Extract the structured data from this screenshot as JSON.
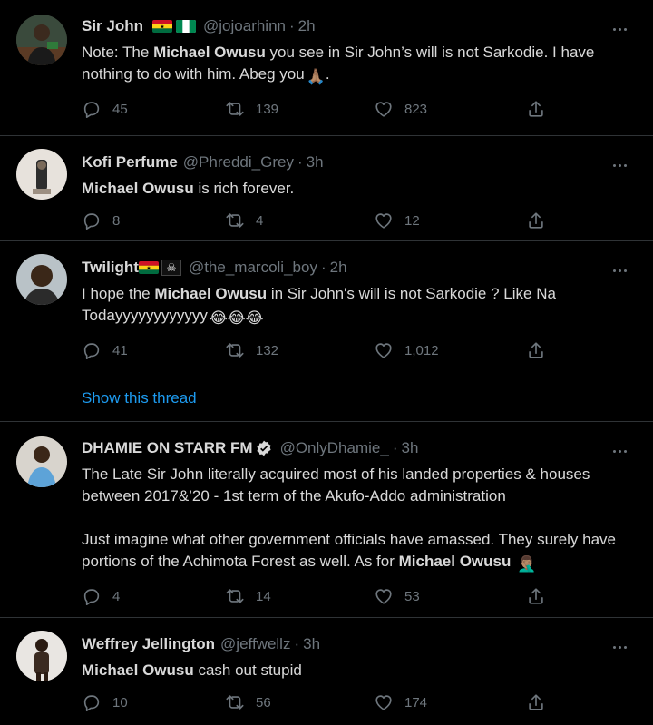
{
  "tweets": [
    {
      "name": "Sir John",
      "handle": "@jojoarhinn",
      "sep": "·",
      "time": "2h",
      "text_parts": [
        "Note: The ",
        "Michael Owusu",
        " you see in Sir John’s will is not Sarkodie. I have nothing to do with him. Abeg you",
        "🙏🏽",
        "."
      ],
      "replies": "45",
      "retweets": "139",
      "likes": "823"
    },
    {
      "name": "Kofi Perfume",
      "handle": "@Phreddi_Grey",
      "sep": "·",
      "time": "3h",
      "text_parts": [
        "Michael Owusu",
        " is rich forever."
      ],
      "replies": "8",
      "retweets": "4",
      "likes": "12"
    },
    {
      "name": "Twilight",
      "name_emoji": "☠",
      "handle": "@the_marcoli_boy",
      "sep": "·",
      "time": "2h",
      "text_parts": [
        "I hope the ",
        "Michael Owusu",
        " in Sir John's will is not Sarkodie ? Like Na Todayyyyyyyyyyyy",
        "😂😂😂"
      ],
      "replies": "41",
      "retweets": "132",
      "likes": "1,012",
      "thread_link": "Show this thread"
    },
    {
      "name": "DHAMIE ON STARR FM",
      "handle": "@OnlyDhamie_",
      "sep": "·",
      "time": "3h",
      "text_p1": "The Late Sir John literally acquired most of his landed properties & houses between 2017&’20 - 1st term of the Akufo-Addo administration",
      "text_parts": [
        "Just imagine what other government officials have amassed. They surely have portions of the Achimota Forest as well. As for ",
        "Michael Owusu",
        " ",
        "🤦🏽‍♂️"
      ],
      "replies": "4",
      "retweets": "14",
      "likes": "53"
    },
    {
      "name": "Weffrey Jellington",
      "handle": "@jeffwellz",
      "sep": "·",
      "time": "3h",
      "text_parts": [
        "Michael Owusu",
        " cash out stupid"
      ],
      "replies": "10",
      "retweets": "56",
      "likes": "174"
    }
  ],
  "colors": {
    "background": "#000000",
    "text": "#d9d9d9",
    "muted": "#6e767d",
    "link": "#1d9bf0",
    "divider": "#2f3336"
  },
  "icons": [
    "reply-icon",
    "retweet-icon",
    "like-icon",
    "share-icon",
    "more-icon",
    "verified-icon",
    "ghana-flag-icon",
    "nigeria-flag-icon"
  ]
}
